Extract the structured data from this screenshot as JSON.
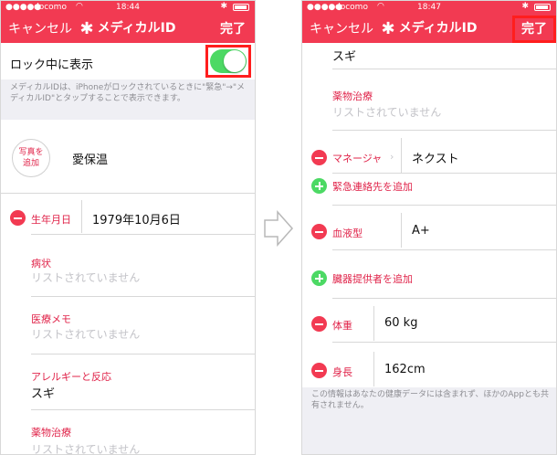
{
  "status": {
    "carrier": "docomo",
    "left_time": "18:44",
    "right_time": "18:47"
  },
  "colors": {
    "accent": "#f23a52",
    "toggle_on": "#4cd964",
    "highlight": "#ff1e1e"
  },
  "left": {
    "nav": {
      "cancel": "キャンセル",
      "title": "メディカルID",
      "done": "完了"
    },
    "lock_label": "ロック中に表示",
    "lock_toggle_on": true,
    "lock_note": "メディカルIDは、iPhoneがロックされているときに\"緊急\"→\"メディカルID\"とタップすることで表示できます。",
    "photo_label_1": "写真を",
    "photo_label_2": "追加",
    "name": "愛保温",
    "birthday_label": "生年月日",
    "birthday_value": "1979年10月6日",
    "sections": [
      {
        "label": "病状",
        "value": "リストされていません"
      },
      {
        "label": "医療メモ",
        "value": "リストされていません"
      },
      {
        "label": "アレルギーと反応",
        "value": "スギ"
      },
      {
        "label": "薬物治療",
        "value": "リストされていません"
      }
    ]
  },
  "right": {
    "nav": {
      "cancel": "キャンセル",
      "title": "メディカルID",
      "done": "完了"
    },
    "allergy_tail": "スギ",
    "meds_label": "薬物治療",
    "meds_value": "リストされていません",
    "contact_label": "マネージャ",
    "contact_value": "ネクスト",
    "add_emergency": "緊急連絡先を追加",
    "blood_label": "血液型",
    "blood_value": "A+",
    "add_donor": "臓器提供者を追加",
    "weight_label": "体重",
    "weight_value": "60 kg",
    "height_label": "身長",
    "height_value": "162cm",
    "footer_note": "この情報はあなたの健康データには含まれず、ほかのAppとも共有されません。"
  }
}
